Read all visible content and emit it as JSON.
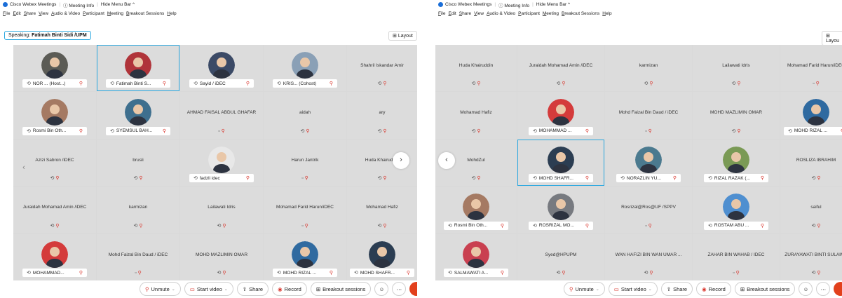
{
  "left": {
    "titlebar": {
      "app": "Cisco Webex Meetings",
      "info": "Meeting Info",
      "hide": "Hide Menu Bar ^"
    },
    "menu": [
      "File",
      "Edit",
      "Share",
      "View",
      "Audio & Video",
      "Participant",
      "Meeting",
      "Breakout Sessions",
      "Help"
    ],
    "speaking_label": "Speaking:",
    "speaking_name": "Fatimah Binti Sidi /UPM",
    "layout_label": "Layout",
    "tiles": [
      {
        "kind": "video",
        "tag": "NOR ... (Host...)",
        "avatar": "#5b5b55"
      },
      {
        "kind": "video",
        "tag": "Fatimah Binti S...",
        "avatar": "#b0343a",
        "sel": true
      },
      {
        "kind": "video",
        "tag": "Sayid / iDEC",
        "avatar": "#3b4a66"
      },
      {
        "kind": "video",
        "tag": "KRIS... (Cohost)",
        "avatar": "#8aa0b6"
      },
      {
        "kind": "name",
        "name": "Shahril Iskandar Amir"
      },
      {
        "kind": "video",
        "tag": "Rosmi Bin Oth...",
        "avatar": "#a57a63"
      },
      {
        "kind": "video",
        "tag": "SYEMSUL BAH...",
        "avatar": "#3e6f8e"
      },
      {
        "kind": "name",
        "name": "AHMAD FAISAL ABDUL GHAFAR",
        "status": "mic"
      },
      {
        "kind": "name",
        "name": "aidah",
        "status": "conn"
      },
      {
        "kind": "name",
        "name": "ary",
        "status": "conn"
      },
      {
        "kind": "name",
        "name": "Azizi Sabron /iDEC",
        "status": "conn"
      },
      {
        "kind": "name",
        "name": "brusli",
        "status": "conn"
      },
      {
        "kind": "video",
        "tag": "fadzli idec",
        "avatar": "#e8e8e8"
      },
      {
        "kind": "name",
        "name": "Harun Jantrik",
        "status": "mic"
      },
      {
        "kind": "name",
        "name": "Huda Khairuddin",
        "status": "conn"
      },
      {
        "kind": "name",
        "name": "Juraidah Mohamad Amin /iDEC",
        "status": "conn"
      },
      {
        "kind": "name",
        "name": "karmizan",
        "status": "conn"
      },
      {
        "kind": "name",
        "name": "Lailawati Idris",
        "status": "conn"
      },
      {
        "kind": "name",
        "name": "Mohamad Farid Harun/iDEC",
        "status": "mic"
      },
      {
        "kind": "name",
        "name": "Mohamad Hafiz",
        "status": "conn"
      },
      {
        "kind": "video",
        "tag": "MOHAMMAD...",
        "avatar": "#d43b3b"
      },
      {
        "kind": "name",
        "name": "Mohd Faizal Bin Daud / iDEC",
        "status": "mic"
      },
      {
        "kind": "name",
        "name": "MOHD MAZLIMIN OMAR",
        "status": "conn"
      },
      {
        "kind": "video",
        "tag": "MOHD RIZAL ...",
        "avatar": "#2f6aa0"
      },
      {
        "kind": "video",
        "tag": "MOHD SHAFR...",
        "avatar": "#2b3d52"
      }
    ],
    "controls": {
      "unmute": "Unmute",
      "video": "Start video",
      "share": "Share",
      "record": "Record",
      "breakout": "Breakout sessions"
    }
  },
  "right": {
    "titlebar": {
      "app": "Cisco Webex Meetings",
      "info": "Meeting Info",
      "hide": "Hide Menu Bar ^"
    },
    "menu": [
      "File",
      "Edit",
      "Share",
      "View",
      "Audio & Video",
      "Participant",
      "Meeting",
      "Breakout Sessions",
      "Help"
    ],
    "layout_label": "Layou",
    "tiles": [
      {
        "kind": "name",
        "name": "Huda Khairuddin",
        "status": "conn"
      },
      {
        "kind": "name",
        "name": "Juraidah Mohamad Amin /iDEC",
        "status": "conn"
      },
      {
        "kind": "name",
        "name": "karmizan",
        "status": "conn"
      },
      {
        "kind": "name",
        "name": "Lailawati Idris",
        "status": "conn"
      },
      {
        "kind": "name",
        "name": "Mohamad Farid Harun/iDEC",
        "status": "mic"
      },
      {
        "kind": "name",
        "name": "Mohamad Hafiz",
        "status": "conn"
      },
      {
        "kind": "video",
        "tag": "MOHAMMAD ...",
        "avatar": "#d43b3b"
      },
      {
        "kind": "name",
        "name": "Mohd Faizal Bin Daud / iDEC",
        "status": "mic"
      },
      {
        "kind": "name",
        "name": "MOHD MAZLIMIN OMAR",
        "status": "conn"
      },
      {
        "kind": "video",
        "tag": "MOHD RIZAL ...",
        "avatar": "#2f6aa0"
      },
      {
        "kind": "name",
        "name": "MohdZul",
        "status": "conn"
      },
      {
        "kind": "video",
        "tag": "MOHD SHAFR...",
        "avatar": "#2b3d52",
        "sel": true
      },
      {
        "kind": "video",
        "tag": "NORAZLIN YU...",
        "avatar": "#4b7a8f"
      },
      {
        "kind": "video",
        "tag": "RIZAL RAZAK (...",
        "avatar": "#7a9a55"
      },
      {
        "kind": "name",
        "name": "ROSLIZA IBRAHIM",
        "status": "conn"
      },
      {
        "kind": "video",
        "tag": "Rosmi Bin Oth...",
        "avatar": "#a57a63"
      },
      {
        "kind": "video",
        "tag": "ROSRIZAL MO...",
        "avatar": "#777a80"
      },
      {
        "kind": "name",
        "name": "Rosrizal@Ros@UF /SPPV",
        "status": "mic"
      },
      {
        "kind": "video",
        "tag": "ROSTAM ABU ...",
        "avatar": "#4f8fd0"
      },
      {
        "kind": "name",
        "name": "saiful",
        "status": "conn"
      },
      {
        "kind": "video",
        "tag": "SALMAWATI A...",
        "avatar": "#c94050"
      },
      {
        "kind": "name",
        "name": "Syed@HPUPM",
        "status": "conn"
      },
      {
        "kind": "name",
        "name": "WAN HAFIZI BIN WAN UMAR ...",
        "status": "conn"
      },
      {
        "kind": "name",
        "name": "ZAHAR BIN WAHAB / IDEC",
        "status": "mic"
      },
      {
        "kind": "name",
        "name": "ZURAYAWATI BINTI SULAIMA",
        "status": "conn"
      }
    ],
    "controls": {
      "unmute": "Unmute",
      "video": "Start video",
      "share": "Share",
      "record": "Record",
      "breakout": "Breakout sessions"
    }
  }
}
